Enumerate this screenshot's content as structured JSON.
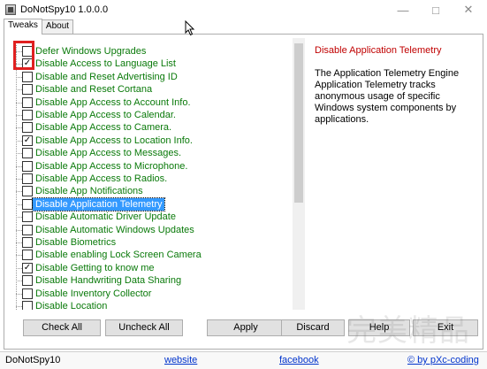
{
  "window": {
    "title": "DoNotSpy10 1.0.0.0",
    "icons": {
      "app": "app-icon",
      "minimize": "minimize-icon",
      "maximize": "maximize-icon",
      "close": "close-icon"
    }
  },
  "tabs": [
    {
      "label": "Tweaks",
      "active": true
    },
    {
      "label": "About",
      "active": false
    }
  ],
  "tweaks": [
    {
      "label": "Defer Windows Upgrades",
      "checked": false
    },
    {
      "label": "Disable Access to Language List",
      "checked": true
    },
    {
      "label": "Disable and Reset Advertising ID",
      "checked": false
    },
    {
      "label": "Disable and Reset Cortana",
      "checked": false
    },
    {
      "label": "Disable App Access to Account Info.",
      "checked": false
    },
    {
      "label": "Disable App Access to Calendar.",
      "checked": false
    },
    {
      "label": "Disable App Access to Camera.",
      "checked": false
    },
    {
      "label": "Disable App Access to Location Info.",
      "checked": true
    },
    {
      "label": "Disable App Access to Messages.",
      "checked": false
    },
    {
      "label": "Disable App Access to Microphone.",
      "checked": false
    },
    {
      "label": "Disable App Access to Radios.",
      "checked": false
    },
    {
      "label": "Disable App Notifications",
      "checked": false
    },
    {
      "label": "Disable Application Telemetry",
      "checked": false,
      "selected": true
    },
    {
      "label": "Disable Automatic Driver Update",
      "checked": false
    },
    {
      "label": "Disable Automatic Windows Updates",
      "checked": false
    },
    {
      "label": "Disable Biometrics",
      "checked": false
    },
    {
      "label": "Disable enabling Lock Screen Camera",
      "checked": false
    },
    {
      "label": "Disable Getting to know me",
      "checked": true
    },
    {
      "label": "Disable Handwriting Data Sharing",
      "checked": false
    },
    {
      "label": "Disable Inventory Collector",
      "checked": false
    },
    {
      "label": "Disable Location",
      "checked": false
    }
  ],
  "description": {
    "title": "Disable Application Telemetry",
    "body": "The Application Telemetry Engine Application Telemetry tracks anonymous usage of specific Windows system components by applications."
  },
  "buttons": {
    "check_all": "Check All",
    "uncheck_all": "Uncheck All",
    "apply": "Apply",
    "discard": "Discard",
    "help": "Help",
    "exit": "Exit"
  },
  "status": {
    "app_name": "DoNotSpy10",
    "website": "website",
    "facebook": "facebook",
    "credit": "© by pXc-coding"
  },
  "watermark": "完美精品",
  "colors": {
    "label_green": "#0a7a0a",
    "selection_blue": "#3399ff",
    "description_title_red": "#c00000",
    "highlight_red": "#e02020",
    "link_blue": "#0033cc"
  }
}
